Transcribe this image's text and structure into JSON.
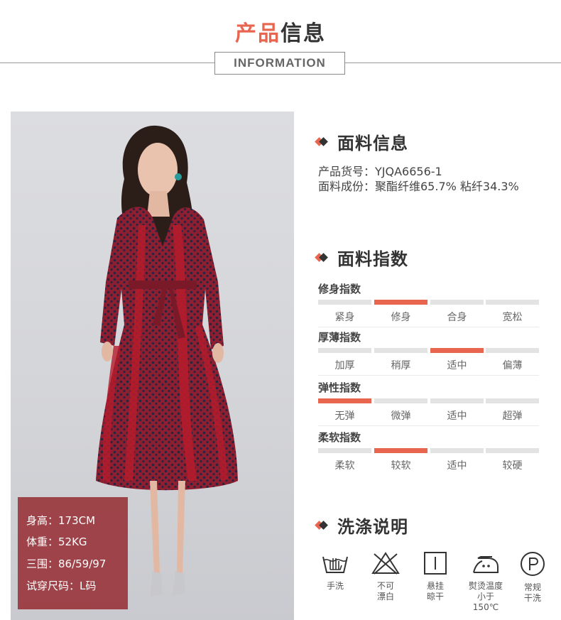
{
  "header": {
    "title_accent": "产品",
    "title_rest": "信息",
    "subtitle": "INFORMATION"
  },
  "model": {
    "height": "身高：173CM",
    "weight": "体重：52KG",
    "measurements": "三围：86/59/97",
    "size": "试穿尺码：L码"
  },
  "fabric_info": {
    "heading": "面料信息",
    "item_no": "产品货号：YJQA6656-1",
    "composition": "面料成份：聚酯纤维65.7%  粘纤34.3%"
  },
  "fabric_index": {
    "heading": "面料指数",
    "rows": [
      {
        "title": "修身指数",
        "options": [
          "紧身",
          "修身",
          "合身",
          "宽松"
        ],
        "active": 1
      },
      {
        "title": "厚薄指数",
        "options": [
          "加厚",
          "稍厚",
          "适中",
          "偏薄"
        ],
        "active": 2
      },
      {
        "title": "弹性指数",
        "options": [
          "无弹",
          "微弹",
          "适中",
          "超弹"
        ],
        "active": 0
      },
      {
        "title": "柔软指数",
        "options": [
          "柔软",
          "较软",
          "适中",
          "较硬"
        ],
        "active": 1
      }
    ]
  },
  "washing": {
    "heading": "洗涤说明",
    "items": [
      {
        "icon": "hand-wash-icon",
        "label": "手洗"
      },
      {
        "icon": "no-bleach-icon",
        "label": "不可\n漂白"
      },
      {
        "icon": "hang-dry-icon",
        "label": "悬挂\n晾干"
      },
      {
        "icon": "iron-icon",
        "label": "熨烫温度\n小于150℃"
      },
      {
        "icon": "dry-clean-icon",
        "label": "常规\n干洗"
      }
    ]
  },
  "colors": {
    "accent": "#e8664f",
    "overlay": "#96303a",
    "dress": "#8e1f30"
  }
}
